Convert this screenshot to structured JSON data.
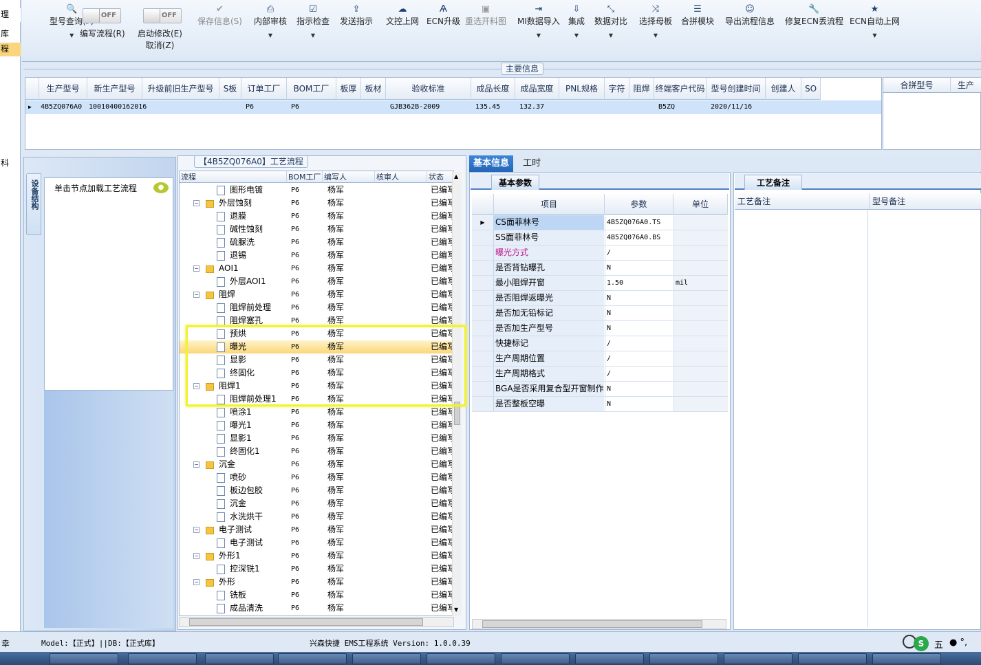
{
  "left_strip": {
    "items": [
      "理",
      "库",
      "程",
      "科"
    ]
  },
  "toolbar": {
    "items": [
      {
        "label": "型号查询(F)",
        "icon": "search-icon",
        "glyph": "🔍",
        "has_arrow": true,
        "disabled": false
      },
      {
        "label": "编写流程(R)",
        "toggle": "OFF"
      },
      {
        "label": "启动修改(E)",
        "label2": "取消(Z)",
        "toggle": "OFF"
      },
      {
        "label": "保存信息(S)",
        "icon": "check-icon",
        "glyph": "✔",
        "disabled": true
      },
      {
        "label": "内部审核",
        "icon": "print-icon",
        "glyph": "⎙",
        "has_arrow": true
      },
      {
        "label": "指示检查",
        "icon": "checklist-icon",
        "glyph": "☑",
        "has_arrow": true
      },
      {
        "label": "发送指示",
        "icon": "upload-icon",
        "glyph": "⇪"
      },
      {
        "label": "文控上网",
        "icon": "cloud-upload-icon",
        "glyph": "☁"
      },
      {
        "label": "ECN升级",
        "icon": "ecn-icon",
        "glyph": "Ѧ"
      },
      {
        "label": "重选开料图",
        "icon": "image-icon",
        "glyph": "▣",
        "disabled": true
      },
      {
        "label": "MI数据导入",
        "icon": "import-icon",
        "glyph": "⇥",
        "has_arrow": true
      },
      {
        "label": "集成",
        "icon": "download-icon",
        "glyph": "⇩",
        "has_arrow": true
      },
      {
        "label": "数据对比",
        "icon": "compare-icon",
        "glyph": "⤡",
        "has_arrow": true
      },
      {
        "label": "选择母板",
        "icon": "shuffle-icon",
        "glyph": "⤨",
        "has_arrow": true
      },
      {
        "label": "合拼模块",
        "icon": "list-icon",
        "glyph": "☰"
      },
      {
        "label": "导出流程信息",
        "icon": "smiley-icon",
        "glyph": "☺"
      },
      {
        "label": "修复ECN丢流程",
        "icon": "wrench-icon",
        "glyph": "🔧"
      },
      {
        "label": "ECN自动上网",
        "icon": "star-icon",
        "glyph": "★",
        "has_arrow": true
      }
    ]
  },
  "main_info": {
    "title": "主要信息",
    "columns": [
      "生产型号",
      "新生产型号",
      "升级前旧生产型号",
      "S板",
      "订单工厂",
      "BOM工厂",
      "板厚",
      "板材",
      "验收标准",
      "成品长度",
      "成品宽度",
      "PNL规格",
      "字符",
      "阻焊",
      "终端客户代码",
      "型号创建时间",
      "创建人",
      "SO"
    ],
    "row": [
      "4B5ZQ076A0",
      "10010400162016",
      "",
      "",
      "P6",
      "P6",
      "",
      "",
      "GJB362B-2009",
      "135.45",
      "132.37",
      "",
      "",
      "",
      "B5ZQ",
      "2020/11/16",
      "",
      ""
    ]
  },
  "merge_grid": {
    "columns": [
      "合拼型号",
      "生产"
    ]
  },
  "left_panel": {
    "vertical_tab": "设备结构",
    "hint": "单击节点加载工艺流程"
  },
  "process": {
    "title": "【4B5ZQ076A0】工艺流程",
    "columns": [
      "流程",
      "BOM工厂",
      "编写人",
      "核审人",
      "状态"
    ],
    "rows": [
      {
        "name": "图形电镀",
        "level": 2,
        "type": "doc",
        "bom": "P6",
        "writer": "杨军",
        "status": "已编写"
      },
      {
        "name": "外层蚀刻",
        "level": 1,
        "type": "folder",
        "bom": "P6",
        "writer": "杨军",
        "status": "已编写"
      },
      {
        "name": "退膜",
        "level": 2,
        "type": "doc",
        "bom": "P6",
        "writer": "杨军",
        "status": "已编写"
      },
      {
        "name": "碱性蚀刻",
        "level": 2,
        "type": "doc",
        "bom": "P6",
        "writer": "杨军",
        "status": "已编写"
      },
      {
        "name": "硫脲洗",
        "level": 2,
        "type": "doc",
        "bom": "P6",
        "writer": "杨军",
        "status": "已编写"
      },
      {
        "name": "退锡",
        "level": 2,
        "type": "doc",
        "bom": "P6",
        "writer": "杨军",
        "status": "已编写"
      },
      {
        "name": "AOI1",
        "level": 1,
        "type": "folder",
        "bom": "P6",
        "writer": "杨军",
        "status": "已编写"
      },
      {
        "name": "外层AOI1",
        "level": 2,
        "type": "doc",
        "bom": "P6",
        "writer": "杨军",
        "status": "已编写"
      },
      {
        "name": "阻焊",
        "level": 1,
        "type": "folder",
        "bom": "P6",
        "writer": "杨军",
        "status": "已编写"
      },
      {
        "name": "阻焊前处理",
        "level": 2,
        "type": "doc",
        "bom": "P6",
        "writer": "杨军",
        "status": "已编写"
      },
      {
        "name": "阻焊塞孔",
        "level": 2,
        "type": "doc",
        "bom": "P6",
        "writer": "杨军",
        "status": "已编写"
      },
      {
        "name": "预烘",
        "level": 2,
        "type": "doc",
        "bom": "P6",
        "writer": "杨军",
        "status": "已编写"
      },
      {
        "name": "曝光",
        "level": 2,
        "type": "doc",
        "bom": "P6",
        "writer": "杨军",
        "status": "已编写",
        "selected": true
      },
      {
        "name": "显影",
        "level": 2,
        "type": "doc",
        "bom": "P6",
        "writer": "杨军",
        "status": "已编写"
      },
      {
        "name": "终固化",
        "level": 2,
        "type": "doc",
        "bom": "P6",
        "writer": "杨军",
        "status": "已编写"
      },
      {
        "name": "阻焊1",
        "level": 1,
        "type": "folder",
        "bom": "P6",
        "writer": "杨军",
        "status": "已编写"
      },
      {
        "name": "阻焊前处理1",
        "level": 2,
        "type": "doc",
        "bom": "P6",
        "writer": "杨军",
        "status": "已编写"
      },
      {
        "name": "喷涂1",
        "level": 2,
        "type": "doc",
        "bom": "P6",
        "writer": "杨军",
        "status": "已编写"
      },
      {
        "name": "曝光1",
        "level": 2,
        "type": "doc",
        "bom": "P6",
        "writer": "杨军",
        "status": "已编写"
      },
      {
        "name": "显影1",
        "level": 2,
        "type": "doc",
        "bom": "P6",
        "writer": "杨军",
        "status": "已编写"
      },
      {
        "name": "终固化1",
        "level": 2,
        "type": "doc",
        "bom": "P6",
        "writer": "杨军",
        "status": "已编写"
      },
      {
        "name": "沉金",
        "level": 1,
        "type": "folder",
        "bom": "P6",
        "writer": "杨军",
        "status": "已编写"
      },
      {
        "name": "喷砂",
        "level": 2,
        "type": "doc",
        "bom": "P6",
        "writer": "杨军",
        "status": "已编写"
      },
      {
        "name": "板边包胶",
        "level": 2,
        "type": "doc",
        "bom": "P6",
        "writer": "杨军",
        "status": "已编写"
      },
      {
        "name": "沉金",
        "level": 2,
        "type": "doc",
        "bom": "P6",
        "writer": "杨军",
        "status": "已编写"
      },
      {
        "name": "水洗烘干",
        "level": 2,
        "type": "doc",
        "bom": "P6",
        "writer": "杨军",
        "status": "已编写"
      },
      {
        "name": "电子测试",
        "level": 1,
        "type": "folder",
        "bom": "P6",
        "writer": "杨军",
        "status": "已编写"
      },
      {
        "name": "电子测试",
        "level": 2,
        "type": "doc",
        "bom": "P6",
        "writer": "杨军",
        "status": "已编写"
      },
      {
        "name": "外形1",
        "level": 1,
        "type": "folder",
        "bom": "P6",
        "writer": "杨军",
        "status": "已编写"
      },
      {
        "name": "控深铣1",
        "level": 2,
        "type": "doc",
        "bom": "P6",
        "writer": "杨军",
        "status": "已编写"
      },
      {
        "name": "外形",
        "level": 1,
        "type": "folder",
        "bom": "P6",
        "writer": "杨军",
        "status": "已编写"
      },
      {
        "name": "铣板",
        "level": 2,
        "type": "doc",
        "bom": "P6",
        "writer": "杨军",
        "status": "已编写"
      },
      {
        "name": "成品清洗",
        "level": 2,
        "type": "doc",
        "bom": "P6",
        "writer": "杨军",
        "status": "已编写"
      }
    ]
  },
  "detail_tabs": [
    "基本信息",
    "工时"
  ],
  "basic_params": {
    "tab": "基本参数",
    "columns": [
      "项目",
      "参数",
      "单位"
    ],
    "rows": [
      {
        "item": "CS面菲林号",
        "value": "4B5ZQ076A0.TS",
        "unit": "",
        "selected": true
      },
      {
        "item": "SS面菲林号",
        "value": "4B5ZQ076A0.BS",
        "unit": ""
      },
      {
        "item": "曝光方式",
        "value": "/",
        "unit": "",
        "highlight": "#c0188a"
      },
      {
        "item": "是否背钻曝孔",
        "value": "N",
        "unit": ""
      },
      {
        "item": "最小阻焊开窗",
        "value": "1.50",
        "unit": "mil"
      },
      {
        "item": "是否阻焊返曝光",
        "value": "N",
        "unit": ""
      },
      {
        "item": "是否加无铅标记",
        "value": "N",
        "unit": ""
      },
      {
        "item": "是否加生产型号",
        "value": "N",
        "unit": ""
      },
      {
        "item": "快捷标记",
        "value": "/",
        "unit": ""
      },
      {
        "item": "生产周期位置",
        "value": "/",
        "unit": ""
      },
      {
        "item": "生产周期格式",
        "value": "/",
        "unit": ""
      },
      {
        "item": "BGA是否采用复合型开窗制作",
        "value": "N",
        "unit": ""
      },
      {
        "item": "是否整板空曝",
        "value": "N",
        "unit": ""
      }
    ]
  },
  "remarks": {
    "tab": "工艺备注",
    "col1": "工艺备注",
    "col2": "型号备注"
  },
  "status_bar": {
    "left": "幸",
    "model": "Model:【正式】||DB:【正式库】",
    "version": "兴森快捷 EMS工程系统 Version: 1.0.0.39",
    "ime": "五"
  }
}
